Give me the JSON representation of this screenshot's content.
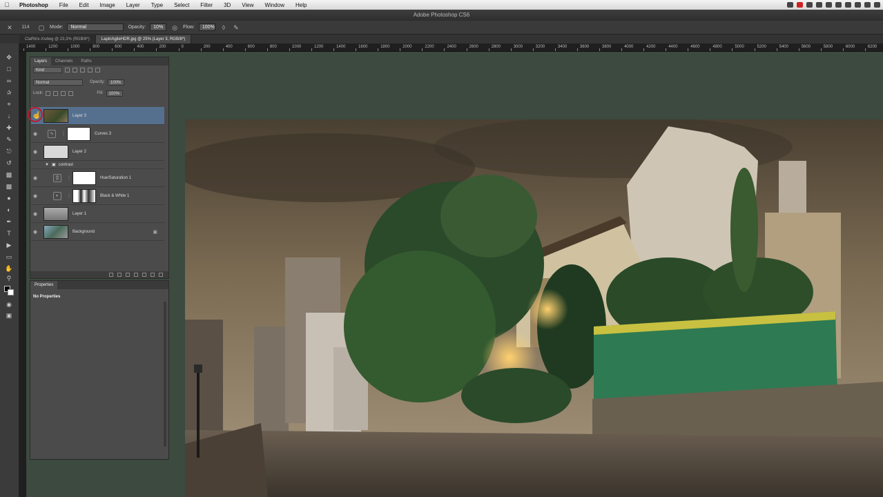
{
  "menubar": {
    "apple": "",
    "items": [
      "Photoshop",
      "File",
      "Edit",
      "Image",
      "Layer",
      "Type",
      "Select",
      "Filter",
      "3D",
      "View",
      "Window",
      "Help"
    ]
  },
  "window": {
    "title": "Adobe Photoshop CS6"
  },
  "options": {
    "brush_size": "114",
    "mode_label": "Mode:",
    "mode_value": "Normal",
    "opacity_label": "Opacity:",
    "opacity_value": "10%",
    "flow_label": "Flow:",
    "flow_value": "100%"
  },
  "tabs": [
    {
      "label": "ClaRtrix-Xsdwg @ 23,3% (RGB/8*)",
      "active": false
    },
    {
      "label": "LapinAgileHDR.jpg @ 25% (Layer 3, RGB/8*)",
      "active": true
    }
  ],
  "ruler": {
    "ticks": [
      "1400",
      "1200",
      "1000",
      "800",
      "600",
      "400",
      "200",
      "0",
      "200",
      "400",
      "600",
      "800",
      "1000",
      "1200",
      "1400",
      "1600",
      "1800",
      "2000",
      "2200",
      "2400",
      "2600",
      "2800",
      "3000",
      "3200",
      "3400",
      "3600",
      "3800",
      "4000",
      "4200",
      "4400",
      "4600",
      "4800",
      "5000",
      "5200",
      "5400",
      "5600",
      "5800",
      "6000",
      "6200"
    ]
  },
  "layers_panel": {
    "tabs": [
      "Layers",
      "Channels",
      "Paths"
    ],
    "kind_label": "Kind",
    "blend_mode": "Normal",
    "opacity_label": "Opacity:",
    "opacity_value": "100%",
    "lock_label": "Lock:",
    "fill_label": "Fill:",
    "fill_value": "100%",
    "layers": [
      {
        "name": "Layer 3",
        "selected": true
      },
      {
        "name": "Curves 3",
        "adjustment": true
      },
      {
        "name": "Layer 2"
      },
      {
        "name": "contrast",
        "group": true
      },
      {
        "name": "Hue/Saturation 1",
        "adjustment": true
      },
      {
        "name": "Black & White 1",
        "adjustment": true
      },
      {
        "name": "Layer 1"
      },
      {
        "name": "Background",
        "locked": true
      }
    ]
  },
  "properties_panel": {
    "title": "Properties",
    "message": "No Properties"
  },
  "colors": {
    "workspace": "#3c4a40",
    "selected_layer": "#55708f",
    "cursor_ring": "#c0192b"
  }
}
